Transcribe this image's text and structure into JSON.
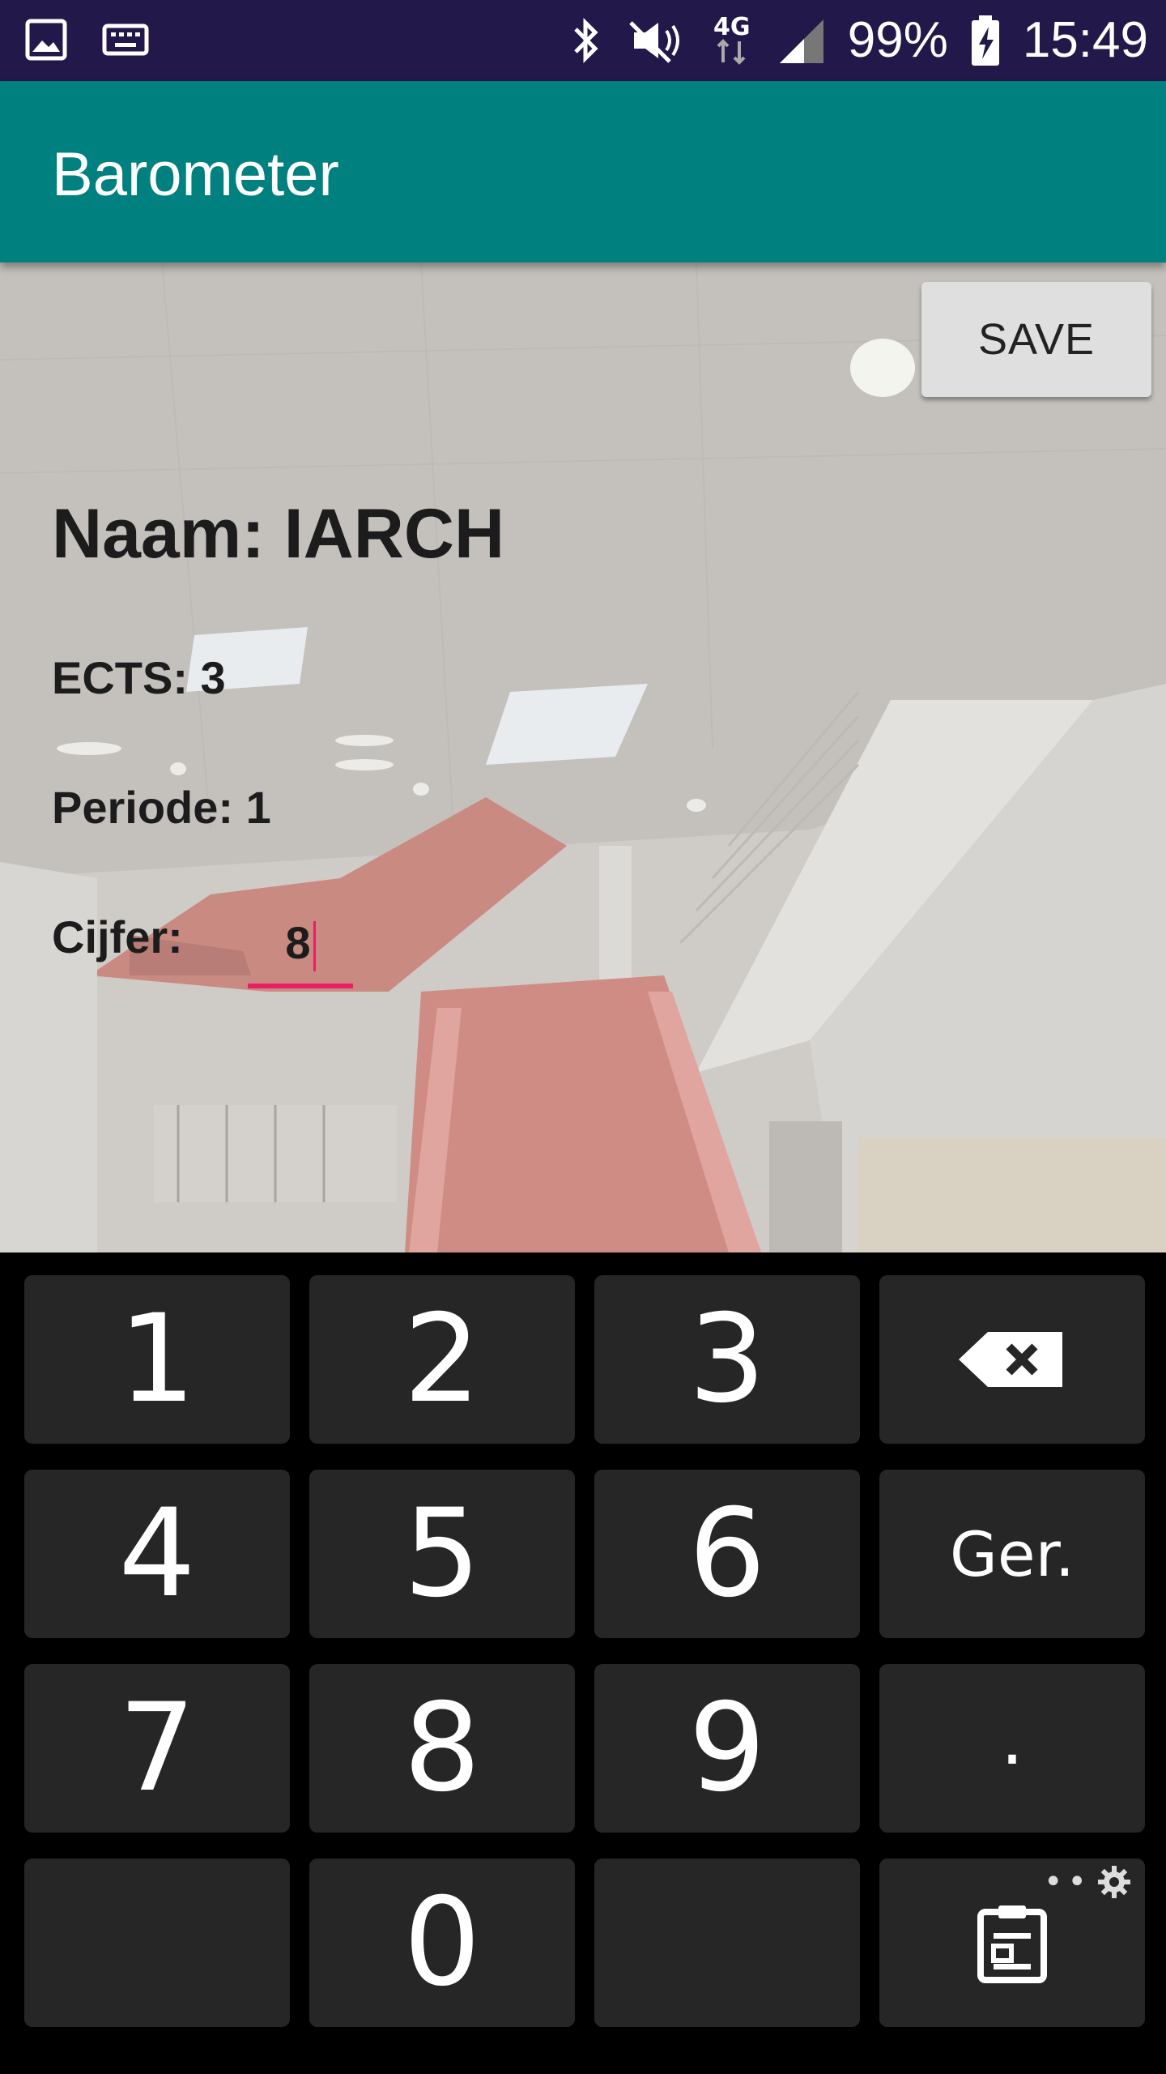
{
  "status_bar": {
    "battery_percent": "99%",
    "time": "15:49",
    "network": "4G"
  },
  "app_bar": {
    "title": "Barometer"
  },
  "form": {
    "save_label": "SAVE",
    "naam": "Naam: IARCH",
    "ects": "ECTS: 3",
    "periode": "Periode: 1",
    "cijfer_label": "Cijfer:",
    "cijfer_value": "8"
  },
  "keyboard": {
    "keys": [
      "1",
      "2",
      "3",
      "4",
      "5",
      "6",
      "Ger.",
      "7",
      "8",
      "9",
      ".",
      "0"
    ],
    "icons": [
      "backspace-icon",
      "clipboard-icon",
      "gear-icon"
    ]
  },
  "colors": {
    "status_bar": "#22184a",
    "app_bar": "#00807f",
    "accent": "#e91e63",
    "key_bg": "#262626"
  }
}
